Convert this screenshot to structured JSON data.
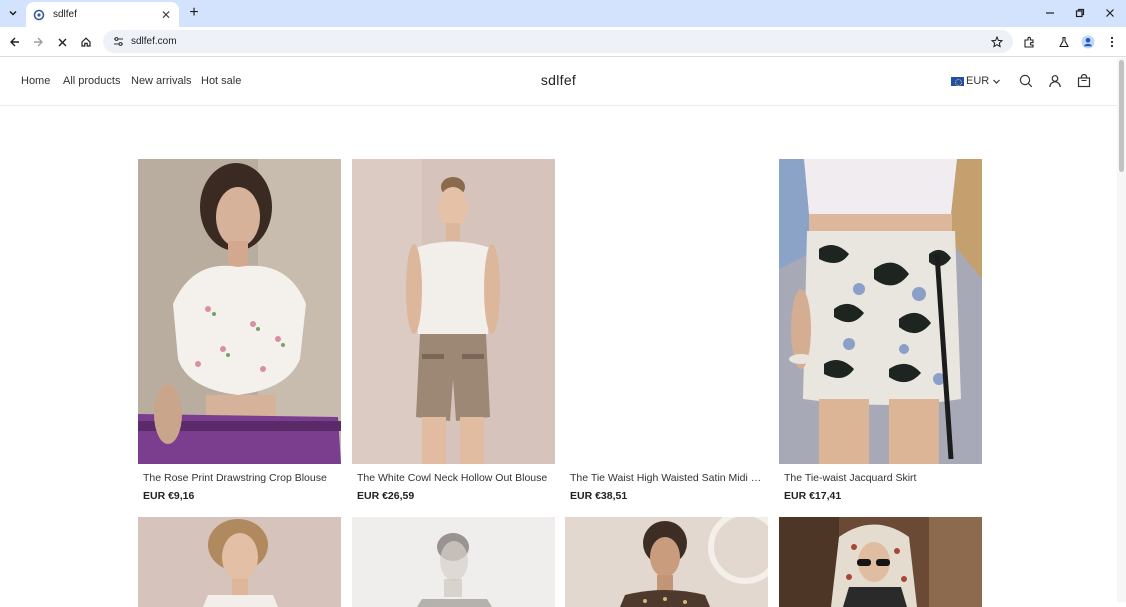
{
  "browser": {
    "tab_title": "sdlfef",
    "url": "sdlfef.com",
    "icons": [
      "tab-list-icon",
      "ebay-favicon-icon",
      "close-icon",
      "plus-icon",
      "minimize-icon",
      "restore-icon",
      "close-window-icon",
      "back-icon",
      "forward-icon",
      "stop-icon",
      "home-icon",
      "tune-icon",
      "star-icon",
      "extensions-icon",
      "labs-icon",
      "profile-icon",
      "menu-icon"
    ]
  },
  "header": {
    "nav": [
      "Home",
      "All products",
      "New arrivals",
      "Hot sale"
    ],
    "brand": "sdlfef",
    "currency": "EUR"
  },
  "products": [
    {
      "name": "The Rose Print Drawstring Crop Blouse",
      "price": "EUR €9,16"
    },
    {
      "name": "The White Cowl Neck Hollow Out Blouse",
      "price": "EUR €26,59"
    },
    {
      "name": "The Tie Waist High Waisted Satin Midi S...",
      "price": "EUR €38,51"
    },
    {
      "name": "The Tie-waist Jacquard Skirt",
      "price": "EUR €17,41"
    }
  ],
  "colors": {
    "tabstrip": "#d3e3fd",
    "omnibox": "#eef1f7",
    "text": "#222222"
  }
}
